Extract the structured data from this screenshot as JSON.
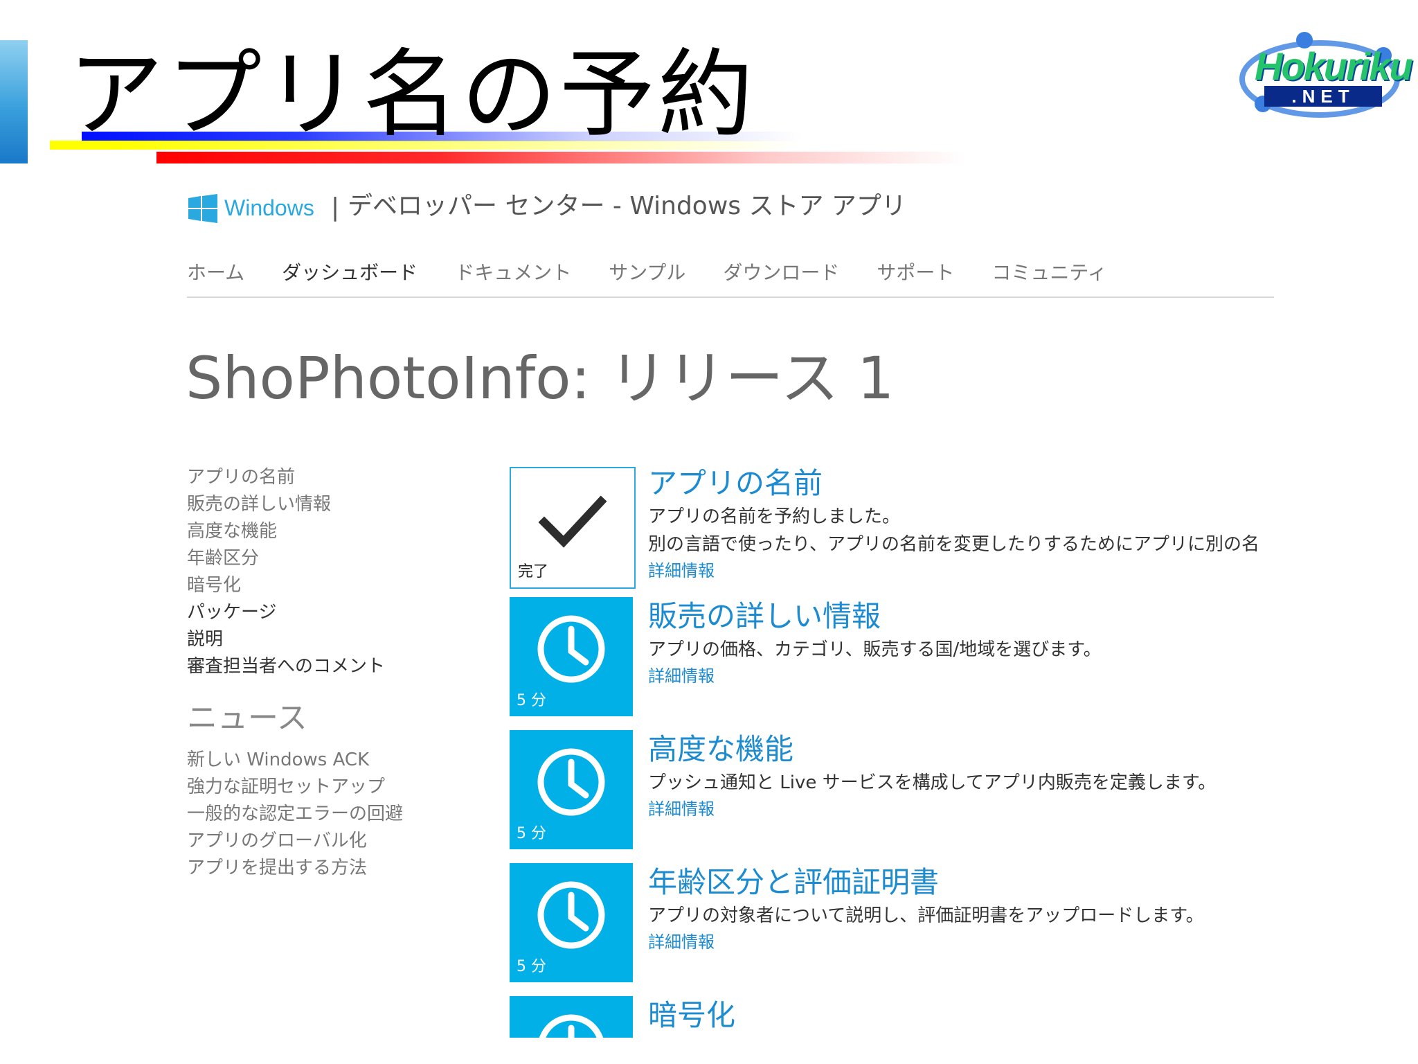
{
  "slide": {
    "title": "アプリ名の予約",
    "logo_top": "Hokuriku",
    "logo_bottom": ".NET"
  },
  "header": {
    "brand": "Windows",
    "separator": "|",
    "subtitle": "デベロッパー センター - Windows ストア アプリ"
  },
  "nav": {
    "items": [
      {
        "label": "ホーム"
      },
      {
        "label": "ダッシュボード"
      },
      {
        "label": "ドキュメント"
      },
      {
        "label": "サンプル"
      },
      {
        "label": "ダウンロード"
      },
      {
        "label": "サポート"
      },
      {
        "label": "コミュニティ"
      }
    ]
  },
  "page": {
    "title": "ShoPhotoInfo: リリース 1"
  },
  "sidebar": {
    "steps": [
      {
        "label": "アプリの名前"
      },
      {
        "label": "販売の詳しい情報"
      },
      {
        "label": "高度な機能"
      },
      {
        "label": "年齢区分"
      },
      {
        "label": "暗号化"
      },
      {
        "label": "パッケージ"
      },
      {
        "label": "説明"
      },
      {
        "label": "審査担当者へのコメント"
      }
    ],
    "news_heading": "ニュース",
    "news": [
      {
        "label": "新しい Windows ACK"
      },
      {
        "label": "強力な証明セットアップ"
      },
      {
        "label": "一般的な認定エラーの回避"
      },
      {
        "label": "アプリのグローバル化"
      },
      {
        "label": "アプリを提出する方法"
      }
    ]
  },
  "steps": [
    {
      "title": "アプリの名前",
      "caption": "完了",
      "desc1": "アプリの名前を予約しました。",
      "desc2": "別の言語で使ったり、アプリの名前を変更したりするためにアプリに別の名",
      "more": "詳細情報"
    },
    {
      "title": "販売の詳しい情報",
      "caption": "5 分",
      "desc1": "アプリの価格、カテゴリ、販売する国/地域を選びます。",
      "more": "詳細情報"
    },
    {
      "title": "高度な機能",
      "caption": "5 分",
      "desc1": "プッシュ通知と Live サービスを構成してアプリ内販売を定義します。",
      "more": "詳細情報"
    },
    {
      "title": "年齢区分と評価証明書",
      "caption": "5 分",
      "desc1": "アプリの対象者について説明し、評価証明書をアップロードします。",
      "more": "詳細情報"
    },
    {
      "title": "暗号化"
    }
  ],
  "colors": {
    "accent_blue": "#1c8bd0",
    "tile_blue": "#00b0e6",
    "windows_blue": "#2aa8e0"
  }
}
